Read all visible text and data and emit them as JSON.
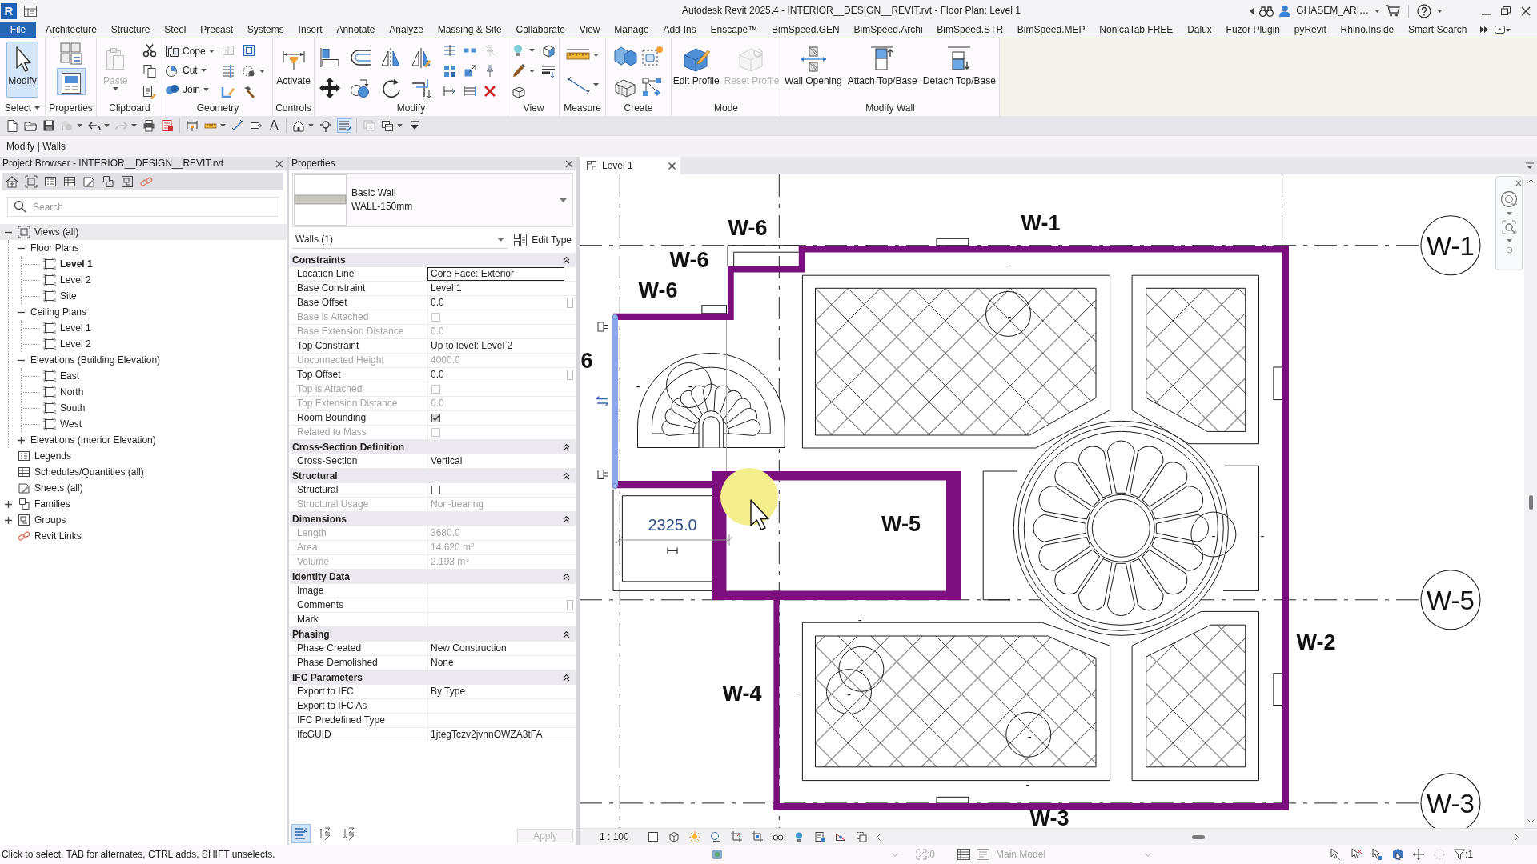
{
  "window": {
    "app_logo": "R",
    "title": "Autodesk Revit 2025.4 - INTERIOR__DESIGN__REVIT.rvt - Floor Plan: Level 1",
    "user": "GHASEM_ARI…"
  },
  "ribbon": {
    "file_tab": "File",
    "tabs": [
      "Architecture",
      "Structure",
      "Steel",
      "Precast",
      "Systems",
      "Insert",
      "Annotate",
      "Analyze",
      "Massing & Site",
      "Collaborate",
      "View",
      "Manage",
      "Add-Ins",
      "Enscape™",
      "BimSpeed.GEN",
      "BimSpeed.Archi",
      "BimSpeed.STR",
      "BimSpeed.MEP",
      "NonicaTab FREE",
      "Dalux",
      "Fuzor Plugin",
      "pyRevit",
      "Rhino.Inside",
      "Smart Search"
    ],
    "panels": [
      {
        "kind": "select",
        "title": "Select",
        "buttons": [
          {
            "label": "Modify",
            "selected": true
          }
        ]
      },
      {
        "kind": "properties",
        "title": "Properties",
        "on": true
      },
      {
        "kind": "clipboard",
        "title": "Clipboard",
        "buttons": [
          {
            "label": "Paste",
            "disabled": true
          }
        ]
      },
      {
        "kind": "geometry",
        "title": "Geometry",
        "buttons": [
          {
            "label": "Cope",
            "disabled": false
          },
          {
            "label": "Cut",
            "disabled": false
          },
          {
            "label": "Join",
            "disabled": false
          }
        ]
      },
      {
        "kind": "controls",
        "title": "Controls",
        "buttons": [
          {
            "label": "Activate",
            "disabled": false
          }
        ]
      },
      {
        "kind": "modify",
        "title": "Modify"
      },
      {
        "kind": "view",
        "title": "View"
      },
      {
        "kind": "measure",
        "title": "Measure"
      },
      {
        "kind": "create",
        "title": "Create"
      },
      {
        "kind": "mode",
        "title": "Mode",
        "buttons": [
          {
            "label": "Edit Profile",
            "disabled": false
          },
          {
            "label": "Reset Profile",
            "disabled": true
          }
        ]
      },
      {
        "kind": "wall",
        "title": "Modify Wall",
        "buttons": [
          {
            "label": "Wall Opening",
            "disabled": false
          },
          {
            "label": "Attach Top/Base",
            "disabled": false
          },
          {
            "label": "Detach Top/Base",
            "disabled": false
          }
        ]
      }
    ]
  },
  "quick_access": {
    "text_glyph": "A",
    "thin_lines_on": true
  },
  "options_bar": {
    "context": "Modify | Walls"
  },
  "project_browser": {
    "title": "Project Browser - INTERIOR__DESIGN__REVIT.rvt",
    "search": {
      "placeholder": "Search"
    },
    "tree": [
      {
        "label": "Views (all)",
        "kind": "views",
        "expanded": true,
        "selected": true,
        "children": [
          {
            "label": "Floor Plans",
            "expanded": true,
            "selected": false,
            "children": [
              {
                "label": "Level 1",
                "kind": "view",
                "selected": false,
                "current": true
              },
              {
                "label": "Level 2",
                "kind": "view",
                "selected": false,
                "current": false
              },
              {
                "label": "Site",
                "kind": "view",
                "selected": false,
                "current": false
              }
            ]
          },
          {
            "label": "Ceiling Plans",
            "expanded": true,
            "selected": false,
            "children": [
              {
                "label": "Level 1",
                "kind": "view",
                "selected": false,
                "current": false
              },
              {
                "label": "Level 2",
                "kind": "view",
                "selected": false,
                "current": false
              }
            ]
          },
          {
            "label": "Elevations (Building Elevation)",
            "expanded": true,
            "selected": false,
            "children": [
              {
                "label": "East",
                "kind": "view",
                "selected": false,
                "current": false
              },
              {
                "label": "North",
                "kind": "view",
                "selected": false,
                "current": false
              },
              {
                "label": "South",
                "kind": "view",
                "selected": false,
                "current": false
              },
              {
                "label": "West",
                "kind": "view",
                "selected": false,
                "current": false
              }
            ]
          },
          {
            "label": "Elevations (Interior Elevation)",
            "expanded": false,
            "selected": false
          }
        ]
      },
      {
        "label": "Legends",
        "kind": "legends",
        "selected": false
      },
      {
        "label": "Schedules/Quantities (all)",
        "kind": "schedules",
        "selected": false
      },
      {
        "label": "Sheets (all)",
        "kind": "sheets",
        "selected": false
      },
      {
        "label": "Families",
        "kind": "families",
        "expanded": false,
        "selected": false
      },
      {
        "label": "Groups",
        "kind": "groups",
        "expanded": false,
        "selected": false
      },
      {
        "label": "Revit Links",
        "kind": "links",
        "selected": false
      }
    ]
  },
  "properties": {
    "title": "Properties",
    "type": {
      "family": "Basic Wall",
      "name": "WALL-150mm"
    },
    "filter": "Walls (1)",
    "edit_type": "Edit Type",
    "groups": [
      {
        "title": "Constraints",
        "expanded": true,
        "rows": [
          {
            "name": "Location Line",
            "kind": "field",
            "value": "Core Face: Exterior",
            "disabled": false
          },
          {
            "name": "Base Constraint",
            "kind": "text",
            "value": "Level 1",
            "disabled": false
          },
          {
            "name": "Base Offset",
            "kind": "param",
            "value": "0.0",
            "disabled": false
          },
          {
            "name": "Base is Attached",
            "kind": "checkbox",
            "checked": false,
            "disabled": true
          },
          {
            "name": "Base Extension Distance",
            "kind": "text",
            "value": "0.0",
            "disabled": true
          },
          {
            "name": "Top Constraint",
            "kind": "text",
            "value": "Up to level: Level 2",
            "disabled": false
          },
          {
            "name": "Unconnected Height",
            "kind": "text",
            "value": "4000.0",
            "disabled": true
          },
          {
            "name": "Top Offset",
            "kind": "param",
            "value": "0.0",
            "disabled": false
          },
          {
            "name": "Top is Attached",
            "kind": "checkbox",
            "checked": false,
            "disabled": true
          },
          {
            "name": "Top Extension Distance",
            "kind": "text",
            "value": "0.0",
            "disabled": true
          },
          {
            "name": "Room Bounding",
            "kind": "checkbox",
            "checked": true,
            "disabled": false
          },
          {
            "name": "Related to Mass",
            "kind": "checkbox",
            "checked": false,
            "disabled": true
          }
        ]
      },
      {
        "title": "Cross-Section Definition",
        "expanded": true,
        "rows": [
          {
            "name": "Cross-Section",
            "kind": "text",
            "value": "Vertical",
            "disabled": false
          }
        ]
      },
      {
        "title": "Structural",
        "expanded": true,
        "rows": [
          {
            "name": "Structural",
            "kind": "checkbox",
            "checked": false,
            "disabled": false
          },
          {
            "name": "Structural Usage",
            "kind": "text",
            "value": "Non-bearing",
            "disabled": true
          }
        ]
      },
      {
        "title": "Dimensions",
        "expanded": true,
        "rows": [
          {
            "name": "Length",
            "kind": "text",
            "value": "3680.0",
            "disabled": true
          },
          {
            "name": "Area",
            "kind": "text",
            "value": "14.620 m$^{2}$",
            "disabled": true
          },
          {
            "name": "Volume",
            "kind": "text",
            "value": "2.193 m$^{3}$",
            "disabled": true
          }
        ]
      },
      {
        "title": "Identity Data",
        "expanded": true,
        "rows": [
          {
            "name": "Image",
            "kind": "text",
            "disabled": false
          },
          {
            "name": "Comments",
            "kind": "param",
            "disabled": false
          },
          {
            "name": "Mark",
            "kind": "text",
            "disabled": false
          }
        ]
      },
      {
        "title": "Phasing",
        "expanded": true,
        "rows": [
          {
            "name": "Phase Created",
            "kind": "text",
            "value": "New Construction",
            "disabled": false
          },
          {
            "name": "Phase Demolished",
            "kind": "text",
            "value": "None",
            "disabled": false
          }
        ]
      },
      {
        "title": "IFC Parameters",
        "expanded": true,
        "rows": [
          {
            "name": "Export to IFC",
            "kind": "text",
            "value": "By Type",
            "disabled": false
          },
          {
            "name": "Export to IFC As",
            "kind": "text",
            "disabled": false
          },
          {
            "name": "IFC Predefined Type",
            "kind": "text",
            "disabled": false
          },
          {
            "name": "IfcGUID",
            "kind": "text",
            "value": "1jtegTczv2jvnnOWZA3tFA",
            "disabled": false
          }
        ]
      }
    ],
    "sort_buttons": [
      {
        "kind": "grouped",
        "selected": true
      },
      {
        "kind": "ascending",
        "selected": false
      },
      {
        "kind": "descending",
        "selected": false
      }
    ],
    "apply": {
      "label": "Apply",
      "disabled": true
    }
  },
  "view": {
    "tabs": [
      {
        "label": "Level 1",
        "selected": true
      }
    ],
    "wall_tags": [
      "W-1",
      "W-6",
      "W-6",
      "W-6",
      "6",
      "W-5",
      "W-4",
      "W-2",
      "W-3"
    ],
    "grid_heads": [
      "W-1",
      "W-5",
      "W-3"
    ],
    "fixture_tags": [
      "-",
      "-",
      "-",
      "-",
      "-",
      "-",
      "-",
      "-",
      "-",
      "-",
      "-",
      "-"
    ],
    "dimension": "2325.0",
    "scale": "1 : 100"
  },
  "status_bar": {
    "message": "Click to select, TAB for alternates, CTRL adds, SHIFT unselects.",
    "editable_count": ":0",
    "design_option": {
      "label": "Main Model",
      "disabled": true
    },
    "filter_count": ":1"
  }
}
